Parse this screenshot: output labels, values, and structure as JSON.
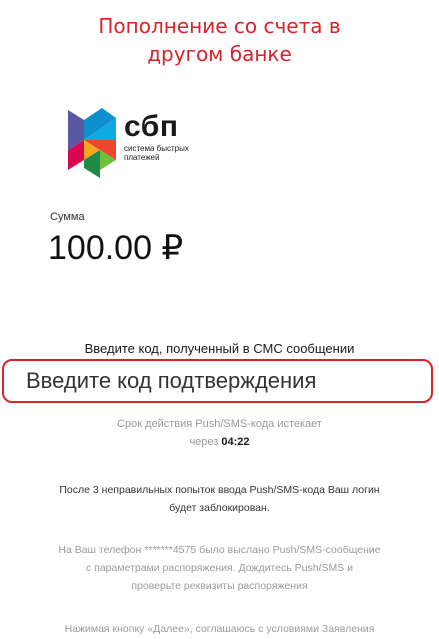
{
  "header": {
    "title_line1": "Пополнение со счета в",
    "title_line2": "другом банке"
  },
  "logo": {
    "word": "сбп",
    "subtitle_line1": "система быстрых",
    "subtitle_line2": "платежей"
  },
  "amount": {
    "label": "Сумма",
    "value": "100.00 ₽"
  },
  "code": {
    "prompt": "Введите код, полученный в СМС сообщении",
    "placeholder": "Введите код подтверждения",
    "value": ""
  },
  "expiry": {
    "line1": "Срок действия Push/SMS-кода истекает",
    "line2_prefix": "через ",
    "timer": "04:22"
  },
  "notices": {
    "block_line1": "После 3 неправильных попыток ввода Push/SMS-кода Ваш логин",
    "block_line2": "будет заблокирован.",
    "phone_line1": "На Ваш телефон *******4575 было выслано Push/SMS-сообщение",
    "phone_line2": "с параметрами распоряжения. Дождитесь Push/SMS и",
    "phone_line3": "проверьте реквизиты распоряжения",
    "next_line1": "Нажимая кнопку «Далее», соглашаюсь с условиями Заявления"
  },
  "colors": {
    "accent": "#d8232a",
    "muted_text": "#9a9a9a",
    "primary_text": "#1a1a1a"
  }
}
